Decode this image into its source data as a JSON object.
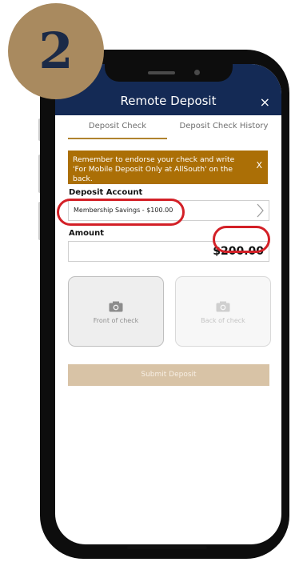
{
  "step_number": "2",
  "app": {
    "title": "Remote Deposit",
    "close_label": "×"
  },
  "tabs": [
    {
      "label": "Deposit Check",
      "active": true
    },
    {
      "label": "Deposit Check History",
      "active": false
    }
  ],
  "banner": {
    "text": "Remember to endorse your check and write 'For Mobile Deposit Only at AllSouth' on the back.",
    "close_label": "X"
  },
  "deposit_account": {
    "label": "Deposit Account",
    "value": "Membership Savings - $100.00"
  },
  "amount": {
    "label": "Amount",
    "value": "$200.00"
  },
  "check_images": {
    "front_label": "Front of check",
    "back_label": "Back of check"
  },
  "submit_label": "Submit Deposit",
  "colors": {
    "header": "#142a55",
    "accent": "#b0832f",
    "banner": "#ab6f06",
    "highlight": "#d32027",
    "badge": "#a98a5f"
  },
  "icons": [
    "camera-icon",
    "chevron-right-icon",
    "close-icon"
  ]
}
